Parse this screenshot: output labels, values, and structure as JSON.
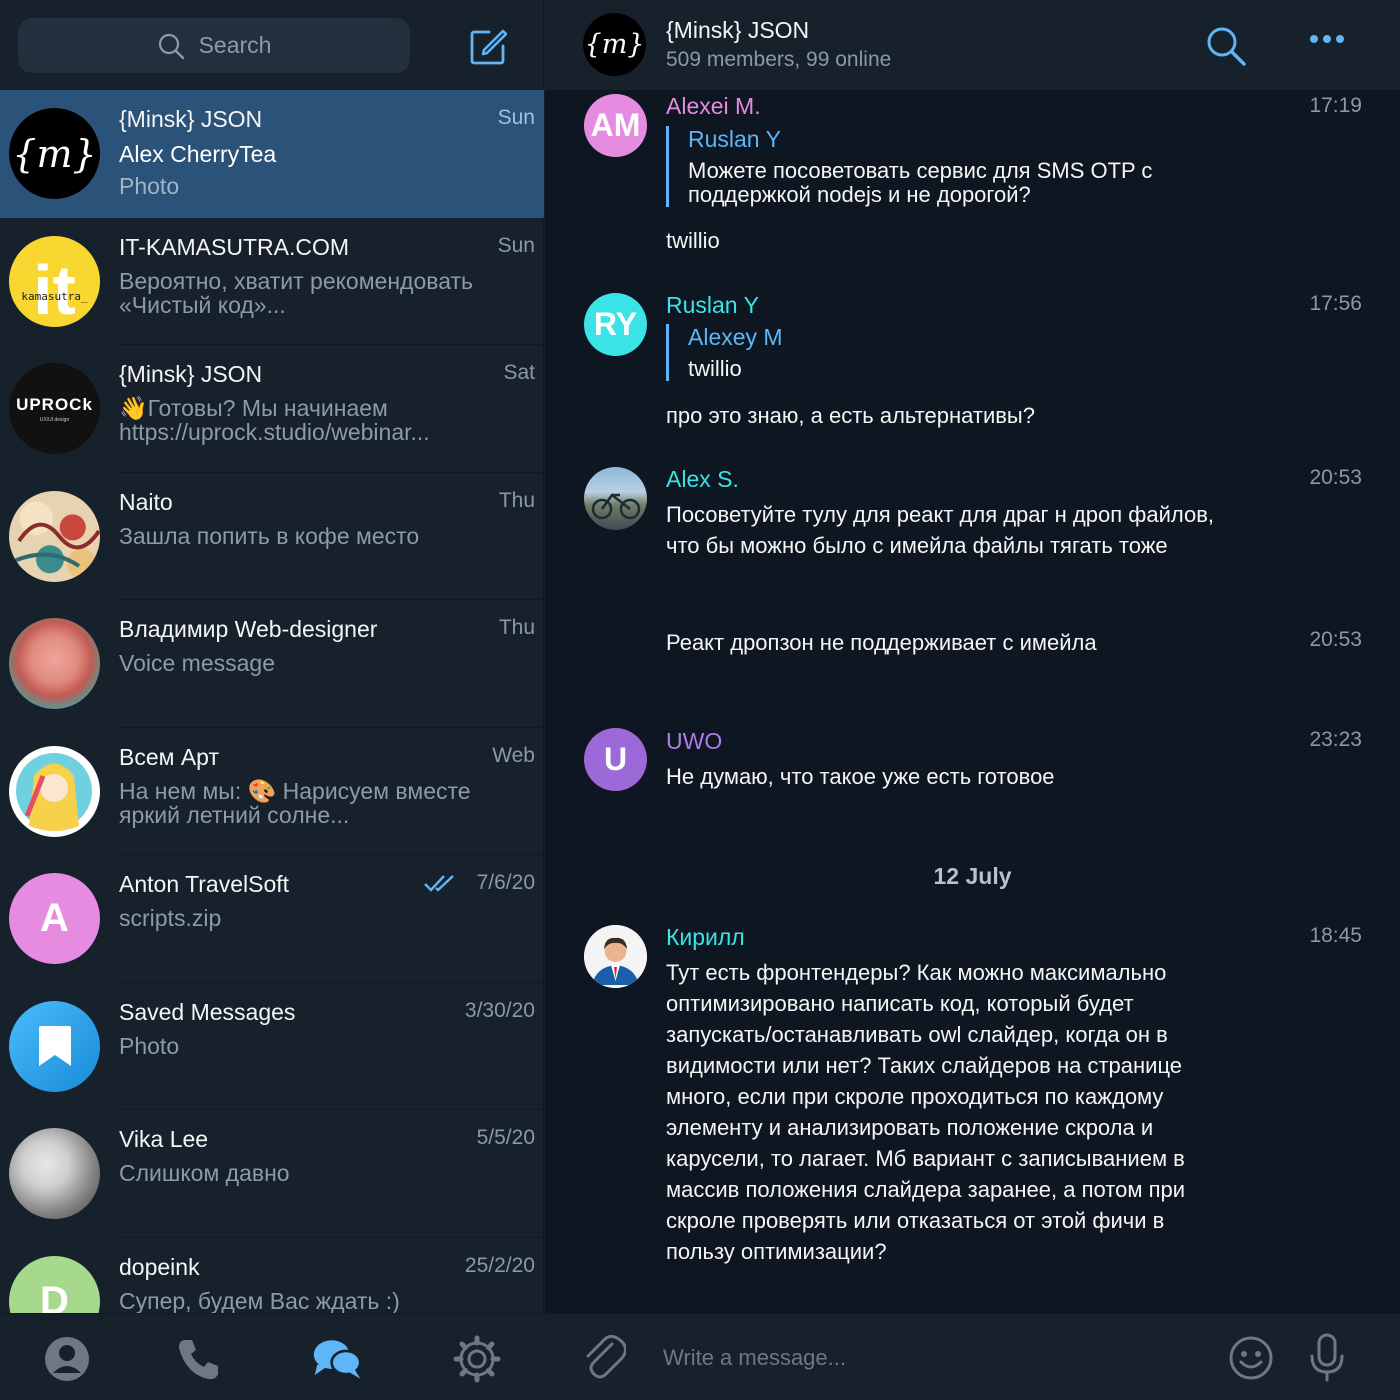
{
  "sidebar": {
    "search_placeholder": "Search",
    "chats": [
      {
        "name": "{Minsk} JSON",
        "date": "Sun",
        "sender": "Alex CherryTea",
        "preview": "Photo"
      },
      {
        "name": "IT-KAMASUTRA.COM",
        "date": "Sun",
        "preview": "Вероятно, хватит рекомендовать «Чистый код»..."
      },
      {
        "name": "{Minsk} JSON",
        "date": "Sat",
        "preview": "👋Готовы? Мы начинаем https://uprock.studio/webinar..."
      },
      {
        "name": "Naito",
        "date": "Thu",
        "preview": "Зашла попить в кофе место"
      },
      {
        "name": "Владимир Web-designer",
        "date": "Thu",
        "preview": "Voice message"
      },
      {
        "name": "Всем Арт",
        "date": "Web",
        "preview": "На нем мы: 🎨 Нарисуем вместе яркий летний солне..."
      },
      {
        "name": "Anton TravelSoft",
        "date": "7/6/20",
        "preview": "scripts.zip",
        "avatar_letter": "A"
      },
      {
        "name": "Saved Messages",
        "date": "3/30/20",
        "preview": "Photo"
      },
      {
        "name": "Vika Lee",
        "date": "5/5/20",
        "preview": "Слишком давно"
      },
      {
        "name": "dopeink",
        "date": "25/2/20",
        "preview": "Супер, будем Вас ждать :)",
        "avatar_letter": "D"
      }
    ],
    "avatar_texts": {
      "it_big": "it",
      "it_small": "kamasutra_",
      "uprock": "UPROCk",
      "uprock_sub": "UX/UI design",
      "minsk": "{m}"
    }
  },
  "chat": {
    "title": "{Minsk} JSON",
    "status": "509 members, 99 online",
    "messages": [
      {
        "author": "Alexei M.",
        "initials": "AM",
        "time": "17:19",
        "reply_name": "Ruslan Y",
        "reply_text": "Можете посоветовать сервис для SMS OTP с поддержкой nodejs и не дорогой?",
        "text": "twillio"
      },
      {
        "author": "Ruslan Y",
        "initials": "RY",
        "time": "17:56",
        "reply_name": "Alexey M",
        "reply_text": "twillio",
        "text": "про это знаю, а есть альтернативы?"
      },
      {
        "author": "Alex S.",
        "time": "20:53",
        "text": "Посоветуйте тулу для реакт для драг н дроп файлов, что бы можно было с имейла файлы тягать тоже"
      },
      {
        "time": "20:53",
        "text": "Реакт дропзон не поддерживает с имейла"
      },
      {
        "author": "UWO",
        "initials": "U",
        "time": "23:23",
        "text": "Не думаю, что такое уже есть готовое"
      },
      {
        "author": "Кирилл",
        "time": "18:45",
        "text": "Тут есть фронтендеры? Как можно максимально оптимизировано написать код, который будет запускать/останавливать owl слайдер, когда он в видимости или нет? Таких слайдеров на странице много, если при скроле проходиться по каждому элементу и анализировать положение скрола и карусели, то лагает. Мб вариант с записыванием в массив положения слайдера заранее, а потом при скроле проверять или отказаться от этой фичи в пользу оптимизации?"
      }
    ],
    "date_separator": "12 July",
    "composer_placeholder": "Write a message..."
  },
  "colors": {
    "accent": "#5eb5f7",
    "active_chat": "#2b5278",
    "sidebar_bg": "#17212b",
    "chat_bg": "#0e1621",
    "author_alexei": "#e58be0",
    "author_ruslan": "#3ae4e6",
    "author_alex_s": "#3ae4e6",
    "author_uwo": "#b07be9",
    "author_kirill": "#3ae4e6"
  },
  "icons": [
    "search-icon",
    "compose-icon",
    "double-check-icon",
    "bookmark-icon",
    "contacts-icon",
    "phone-icon",
    "chats-icon",
    "settings-icon",
    "more-icon",
    "paperclip-icon",
    "emoji-icon",
    "microphone-icon"
  ]
}
